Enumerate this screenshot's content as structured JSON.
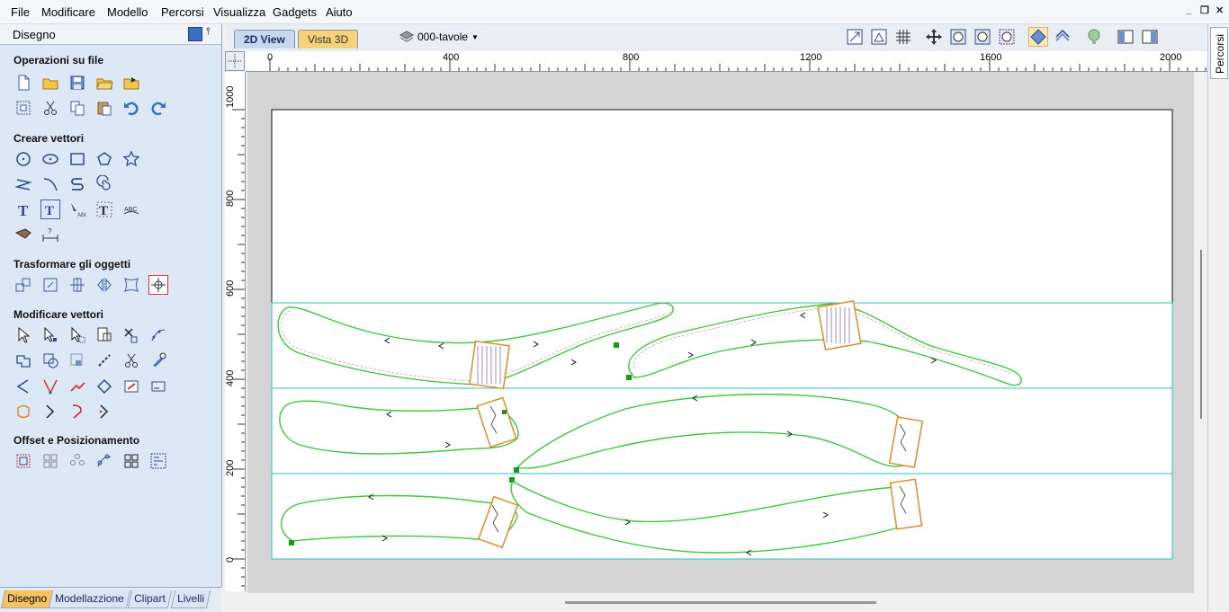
{
  "menu": [
    "File",
    "Modificare",
    "Modello",
    "Percorsi",
    "Visualizza",
    "Gadgets",
    "Aiuto"
  ],
  "window_controls": [
    "_",
    "❐",
    "✕"
  ],
  "panel": {
    "title": "Disegno",
    "sections": {
      "file_ops": "Operazioni su file",
      "create_vectors": "Creare vettori",
      "transform": "Trasformare gli oggetti",
      "edit_vectors": "Modificare vettori",
      "offset": "Offset e Posizionamento"
    },
    "bottom_tabs": [
      "Disegno",
      "Modellazzione",
      "Clipart",
      "Livelli"
    ]
  },
  "view_tabs": {
    "active": "2D View",
    "inactive": "Vista 3D"
  },
  "layer": {
    "name": "000-tavole"
  },
  "right_tab": "Percorsi",
  "rulers": {
    "h_labels": [
      "0",
      "400",
      "800",
      "1200",
      "1600",
      "2000"
    ],
    "v_labels": [
      "1000",
      "800",
      "600",
      "400",
      "200",
      "0"
    ]
  },
  "colors": {
    "panel_bg": "#dce8f6",
    "toolpath_green": "#3cc83c",
    "sheet_line": "#26c6c6",
    "tab_active": "#f7c35c",
    "node_marker": "#1a9a1a",
    "hatch_orange": "#e28a2a"
  }
}
